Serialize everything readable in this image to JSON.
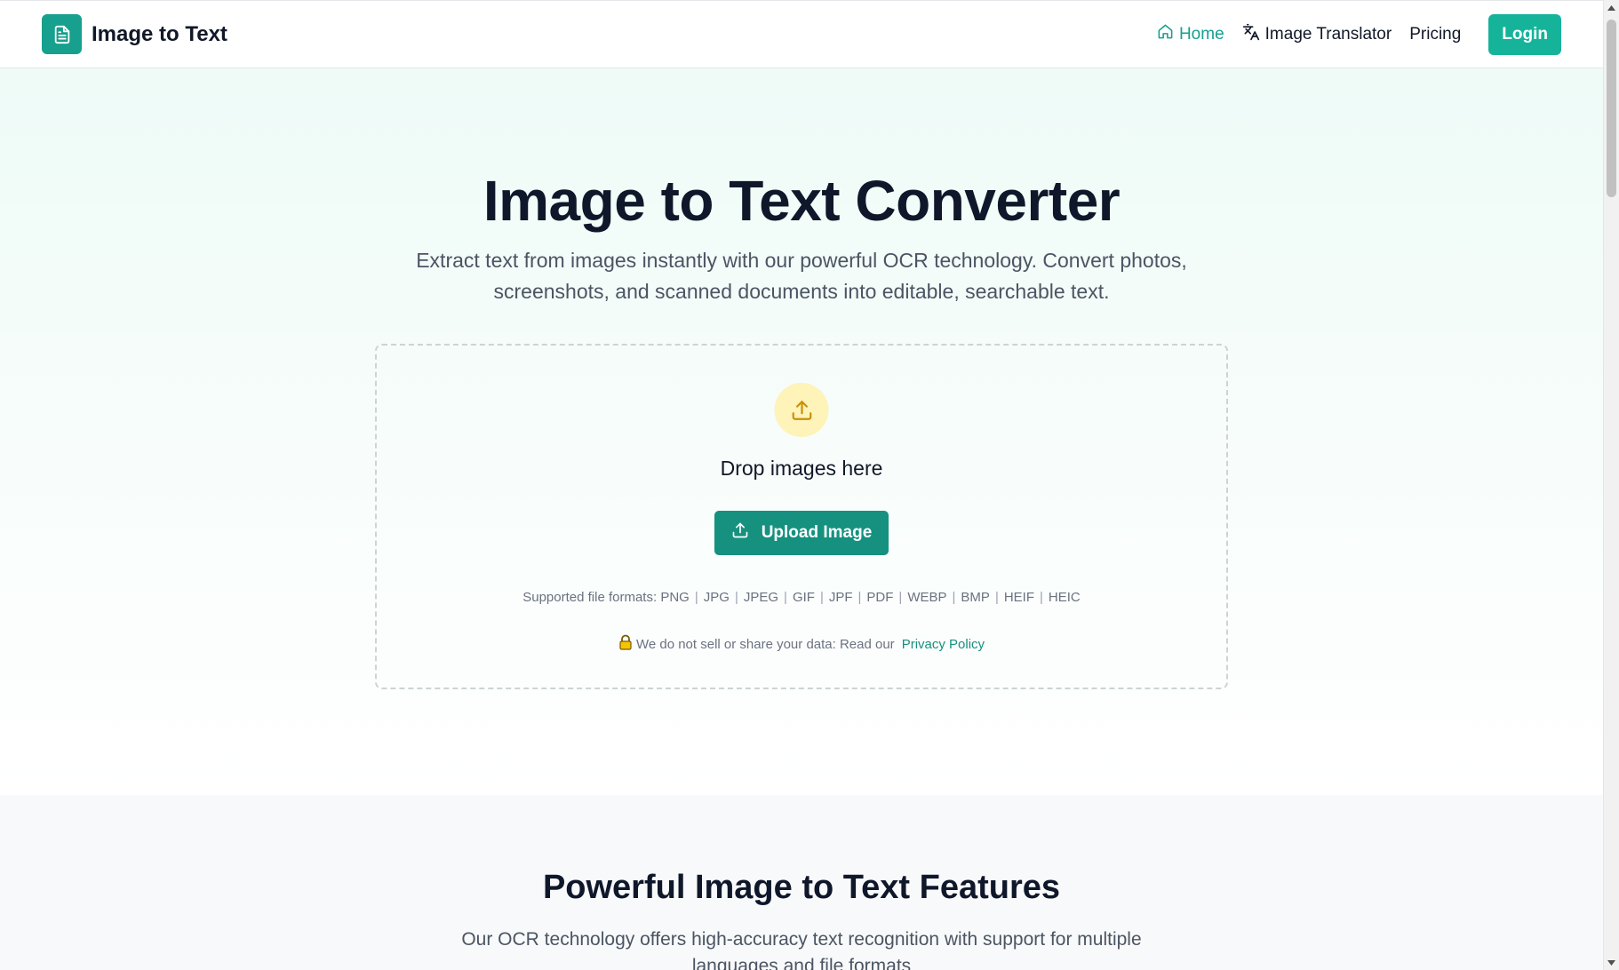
{
  "header": {
    "brand_name": "Image to Text",
    "nav": {
      "home": "Home",
      "translator": "Image Translator",
      "pricing": "Pricing",
      "login": "Login"
    }
  },
  "hero": {
    "title": "Image to Text Converter",
    "subtitle": "Extract text from images instantly with our powerful OCR technology. Convert photos, screenshots, and scanned documents into editable, searchable text."
  },
  "dropzone": {
    "drop_text": "Drop images here",
    "upload_button": "Upload Image",
    "formats_label": "Supported file formats:",
    "formats": [
      "PNG",
      "JPG",
      "JPEG",
      "GIF",
      "JPF",
      "PDF",
      "WEBP",
      "BMP",
      "HEIF",
      "HEIC"
    ],
    "privacy_text": "We do not sell or share your data: Read our",
    "privacy_link": "Privacy Policy"
  },
  "features": {
    "title": "Powerful Image to Text Features",
    "subtitle": "Our OCR technology offers high-accuracy text recognition with support for multiple languages and file formats"
  },
  "colors": {
    "accent": "#16a08d",
    "button": "#16917f",
    "login": "#16b39b",
    "upload_icon_bg": "#fef3b8"
  },
  "icons": {
    "brand": "document-icon",
    "home": "home-icon",
    "translator": "translate-icon",
    "upload": "upload-icon",
    "lock": "lock-icon"
  }
}
